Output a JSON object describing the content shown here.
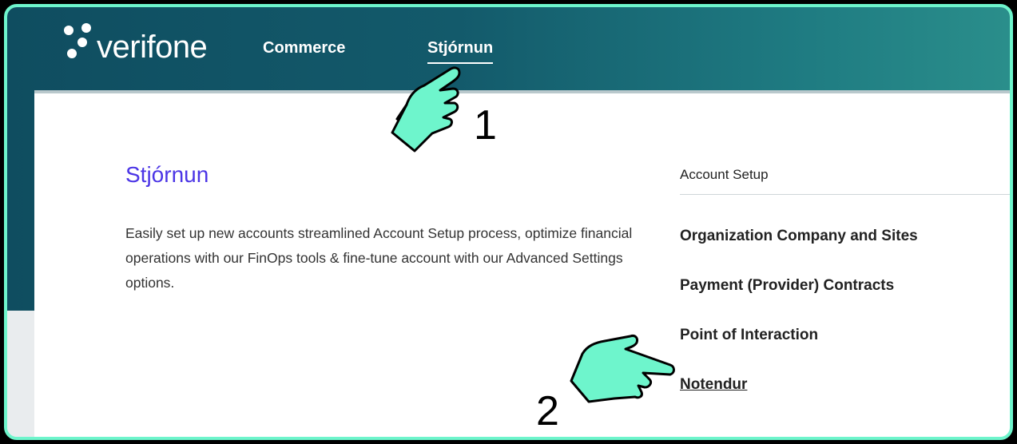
{
  "header": {
    "logo_text": "verifone",
    "nav": [
      {
        "label": "Commerce"
      },
      {
        "label": "Stjórnun"
      }
    ]
  },
  "main": {
    "title": "Stjórnun",
    "description": "Easily set up new accounts streamlined Account Setup process, optimize financial operations with our FinOps tools & fine-tune account with our Advanced Settings options.",
    "section_label": "Account Setup",
    "links": [
      {
        "label": "Organization Company and Sites"
      },
      {
        "label": "Payment (Provider) Contracts"
      },
      {
        "label": "Point of Interaction"
      },
      {
        "label": "Notendur"
      }
    ]
  },
  "annotations": {
    "step1": "1",
    "step2": "2"
  },
  "colors": {
    "accent_frame": "#6ef5cc",
    "title": "#4b35e6",
    "header_dark": "#0f4d60",
    "header_light": "#2a8e8b",
    "pointer_hand": "#6ef5cc"
  },
  "icons": [
    "logo-dots-icon",
    "pointing-hand-icon"
  ]
}
